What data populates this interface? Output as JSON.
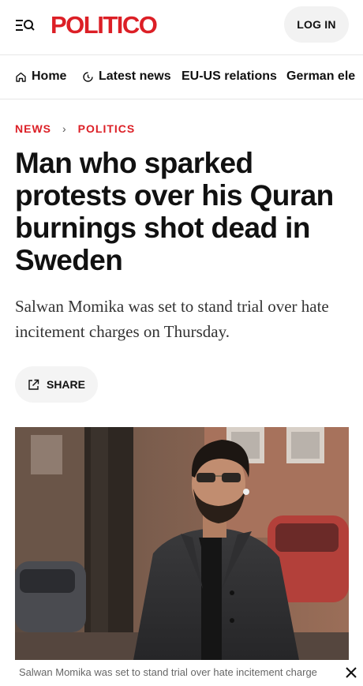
{
  "header": {
    "logo": "POLITICO",
    "login_label": "LOG IN",
    "menu_icon": "menu-search-icon",
    "brand_color": "#dc1f26"
  },
  "nav": {
    "items": [
      {
        "label": "Home",
        "icon": "home-icon"
      },
      {
        "label": "Latest news",
        "icon": "clock-icon"
      },
      {
        "label": "EU-US relations",
        "icon": ""
      },
      {
        "label": "German ele",
        "icon": ""
      }
    ]
  },
  "breadcrumb": {
    "section": "NEWS",
    "separator": "›",
    "topic": "POLITICS"
  },
  "article": {
    "headline": "Man who sparked protests over his Quran burnings shot dead in Sweden",
    "dek": "Salwan Momika was set to stand trial over hate incitement charges on Thursday.",
    "share_label": "SHARE",
    "share_icon": "share-icon"
  },
  "photo": {
    "caption": "Salwan Momika was set to stand trial over hate incitement charge",
    "close_icon": "close-icon"
  }
}
